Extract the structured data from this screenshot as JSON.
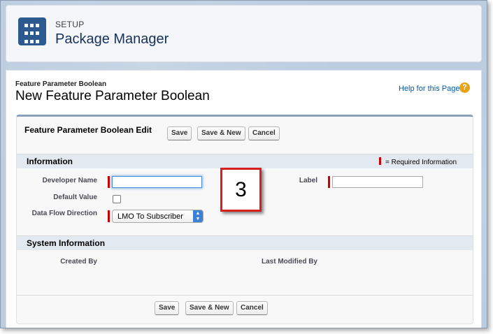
{
  "setup": {
    "eyebrow": "SETUP",
    "title": "Package Manager"
  },
  "page": {
    "eyebrow": "Feature Parameter Boolean",
    "title": "New Feature Parameter Boolean",
    "help_link": "Help for this Page",
    "help_icon": "?"
  },
  "page_block": {
    "title": "Feature Parameter Boolean Edit",
    "buttons": {
      "save": "Save",
      "save_new": "Save & New",
      "cancel": "Cancel"
    }
  },
  "information": {
    "title": "Information",
    "required_legend": "= Required Information",
    "fields": {
      "developer_name_label": "Developer Name",
      "developer_name_value": "",
      "default_value_label": "Default Value",
      "default_value_checked": false,
      "data_flow_label": "Data Flow Direction",
      "data_flow_value": "LMO To Subscriber",
      "label_label": "Label",
      "label_value": ""
    }
  },
  "system_information": {
    "title": "System Information",
    "created_by_label": "Created By",
    "last_modified_by_label": "Last Modified By"
  },
  "callout": {
    "number": "3"
  },
  "colors": {
    "required": "#cc0000",
    "callout_border": "#d71f1f",
    "section_header": "#e3e9f1",
    "setup_icon": "#2c5a8f"
  },
  "icons": {
    "setup": "grid-icon",
    "help": "question-icon",
    "select": "chevron-updown-icon"
  }
}
